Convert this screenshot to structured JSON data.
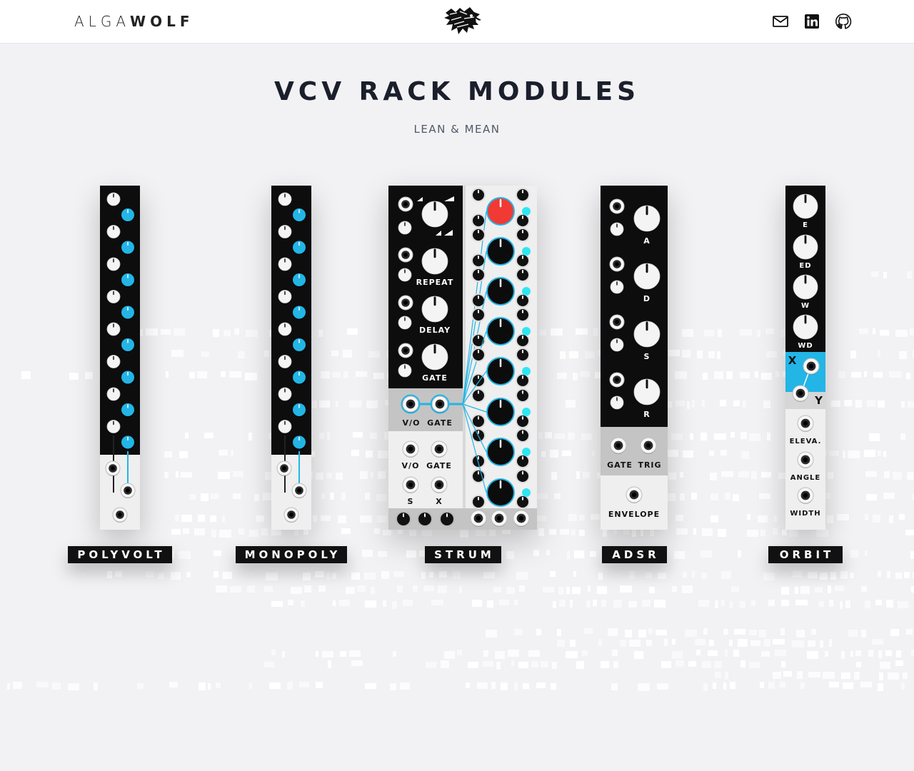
{
  "header": {
    "brand_light": "ALGA",
    "brand_bold": "WOLF",
    "logo_icon": "wolf-head-icon",
    "social": [
      {
        "name": "mail-icon"
      },
      {
        "name": "linkedin-icon"
      },
      {
        "name": "github-icon"
      }
    ]
  },
  "hero": {
    "title": "VCV RACK MODULES",
    "subtitle": "LEAN & MEAN"
  },
  "colors": {
    "accent_blue": "#22b5e6",
    "accent_cyan": "#2ee6f2",
    "knob_red": "#f03a33",
    "panel_black": "#0d0d0d",
    "panel_light": "#efefef",
    "panel_grey": "#c4c4c4"
  },
  "modules": [
    {
      "id": "polyvolt",
      "label": "POLYVOLT"
    },
    {
      "id": "monopoly",
      "label": "MONOPOLY"
    },
    {
      "id": "strum",
      "label": "STRUM",
      "panel_labels": [
        "REPEAT",
        "DELAY",
        "GATE",
        "V/O",
        "GATE",
        "V/O",
        "GATE",
        "S",
        "X"
      ]
    },
    {
      "id": "adsr",
      "label": "ADSR",
      "panel_labels": [
        "A",
        "D",
        "S",
        "R",
        "GATE",
        "TRIG",
        "ENVELOPE"
      ]
    },
    {
      "id": "orbit",
      "label": "ORBIT",
      "panel_labels": [
        "E",
        "ED",
        "W",
        "WD",
        "X",
        "Y",
        "ELEVA.",
        "ANGLE",
        "WIDTH"
      ]
    }
  ]
}
